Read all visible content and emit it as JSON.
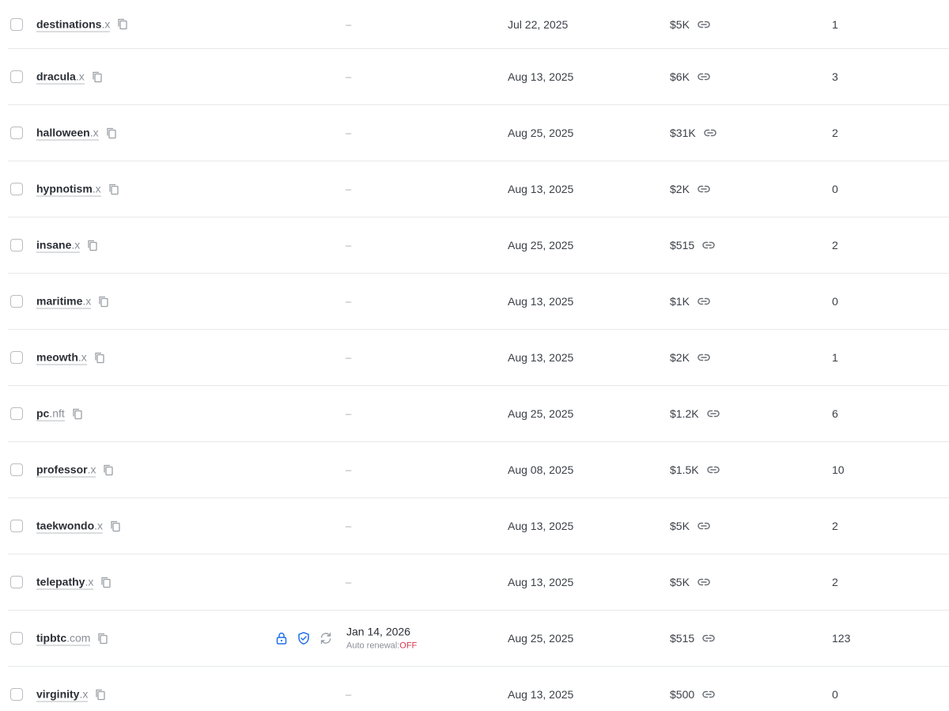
{
  "rows": [
    {
      "name": "destinations",
      "tld": ".x",
      "expiry": "–",
      "date": "Jul 22, 2025",
      "price": "$5K",
      "count": "1"
    },
    {
      "name": "dracula",
      "tld": ".x",
      "expiry": "–",
      "date": "Aug 13, 2025",
      "price": "$6K",
      "count": "3"
    },
    {
      "name": "halloween",
      "tld": ".x",
      "expiry": "–",
      "date": "Aug 25, 2025",
      "price": "$31K",
      "count": "2"
    },
    {
      "name": "hypnotism",
      "tld": ".x",
      "expiry": "–",
      "date": "Aug 13, 2025",
      "price": "$2K",
      "count": "0"
    },
    {
      "name": "insane",
      "tld": ".x",
      "expiry": "–",
      "date": "Aug 25, 2025",
      "price": "$515",
      "count": "2"
    },
    {
      "name": "maritime",
      "tld": ".x",
      "expiry": "–",
      "date": "Aug 13, 2025",
      "price": "$1K",
      "count": "0"
    },
    {
      "name": "meowth",
      "tld": ".x",
      "expiry": "–",
      "date": "Aug 13, 2025",
      "price": "$2K",
      "count": "1"
    },
    {
      "name": "pc",
      "tld": ".nft",
      "expiry": "–",
      "date": "Aug 25, 2025",
      "price": "$1.2K",
      "count": "6"
    },
    {
      "name": "professor",
      "tld": ".x",
      "expiry": "–",
      "date": "Aug 08, 2025",
      "price": "$1.5K",
      "count": "10"
    },
    {
      "name": "taekwondo",
      "tld": ".x",
      "expiry": "–",
      "date": "Aug 13, 2025",
      "price": "$5K",
      "count": "2"
    },
    {
      "name": "telepathy",
      "tld": ".x",
      "expiry": "–",
      "date": "Aug 13, 2025",
      "price": "$5K",
      "count": "2"
    },
    {
      "name": "tipbtc",
      "tld": ".com",
      "expiry_date": "Jan 14, 2026",
      "renewal_label": "Auto renewal:",
      "renewal_value": "OFF",
      "date": "Aug 25, 2025",
      "price": "$515",
      "count": "123",
      "has_actions": true
    },
    {
      "name": "virginity",
      "tld": ".x",
      "expiry": "–",
      "date": "Aug 13, 2025",
      "price": "$500",
      "count": "0"
    }
  ],
  "icons": {
    "copy": "copy-icon",
    "link": "link-icon",
    "lock": "lock-icon",
    "shield": "shield-check-icon",
    "refresh": "refresh-icon"
  },
  "colors": {
    "accent": "#1f6feb",
    "off": "#d8344c"
  }
}
